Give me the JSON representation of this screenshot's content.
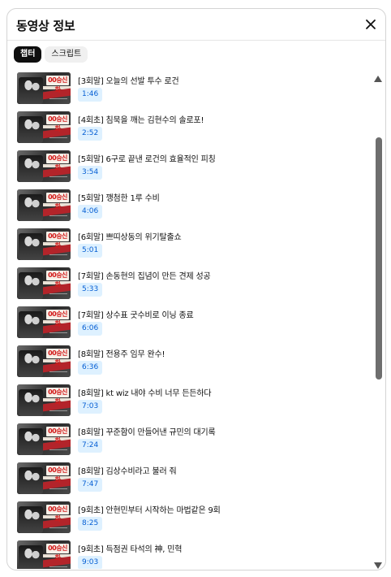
{
  "panel": {
    "title": "동영상 정보",
    "close_icon": "close-icon"
  },
  "chips": [
    {
      "label": "챕터",
      "active": true
    },
    {
      "label": "스크립트",
      "active": false
    }
  ],
  "thumbnail": {
    "badge_text": "00승신화",
    "accent_color": "#b3242a"
  },
  "chapters": [
    {
      "title": "[3회말] 오늘의 선발 투수 로건",
      "time": "1:46"
    },
    {
      "title": "[4회초] 침묵을 깨는 김현수의 솔로포!",
      "time": "2:52"
    },
    {
      "title": "[5회말] 6구로 끝낸 로건의 효율적인 피칭",
      "time": "3:54"
    },
    {
      "title": "[5회말] 깽첨한 1루 수비",
      "time": "4:06"
    },
    {
      "title": "[6회말] 쁘띠상동의 위기탈출쇼",
      "time": "5:01"
    },
    {
      "title": "[7회말] 손동현의 집념이 만든 견제 성공",
      "time": "5:33"
    },
    {
      "title": "[7회말] 상수표 굿수비로 이닝 종료",
      "time": "6:06"
    },
    {
      "title": "[8회말] 전용주 임무 완수!",
      "time": "6:36"
    },
    {
      "title": "[8회말] kt wiz 내야 수비 너무 든든하다",
      "time": "7:03"
    },
    {
      "title": "[8회말] 꾸준함이 만들어낸 규민의 대기록",
      "time": "7:24"
    },
    {
      "title": "[8회말] 김상수비라고 불러 줘",
      "time": "7:47"
    },
    {
      "title": "[9회초] 안현민부터 시작하는 마법같은 9회",
      "time": "8:25"
    },
    {
      "title": "[9회초] 득점권 타석의 神, 민혁",
      "time": "9:03"
    }
  ],
  "colors": {
    "timestamp_bg": "#def1ff",
    "timestamp_text": "#065fd4",
    "active_chip_bg": "#0f0f0f",
    "scrollbar": "#6e6e6e"
  }
}
